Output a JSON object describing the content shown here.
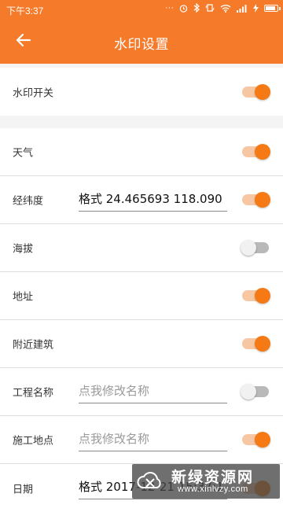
{
  "status_bar": {
    "time": "下午3:37",
    "icons": [
      "dots-icon",
      "alarm-icon",
      "bluetooth-icon",
      "rotate-icon",
      "wifi-icon",
      "signal-icon",
      "charging-icon",
      "battery-icon"
    ],
    "battery_level": 0.9
  },
  "app_bar": {
    "title": "水印设置",
    "back_icon": "arrow-left-icon"
  },
  "colors": {
    "primary": "#f57a2a",
    "switch_on_thumb": "#f57a15",
    "switch_on_track": "#f7c7a4",
    "switch_off_track": "#b9b9b9",
    "background": "#f4f4f4"
  },
  "master": {
    "label": "水印开关",
    "enabled": true
  },
  "settings": [
    {
      "id": "weather",
      "label": "天气",
      "enabled": true
    },
    {
      "id": "coordinates",
      "label": "经纬度",
      "value": "格式 24.465693 118.090",
      "enabled": true
    },
    {
      "id": "altitude",
      "label": "海拔",
      "enabled": false
    },
    {
      "id": "address",
      "label": "地址",
      "enabled": true
    },
    {
      "id": "nearby-building",
      "label": "附近建筑",
      "enabled": true
    },
    {
      "id": "project-name",
      "label": "工程名称",
      "placeholder": "点我修改名称",
      "enabled": false
    },
    {
      "id": "site",
      "label": "施工地点",
      "placeholder": "点我修改名称",
      "enabled": true
    },
    {
      "id": "date",
      "label": "日期",
      "value": "格式 2017-12-21 15:37:1",
      "enabled": true
    }
  ],
  "watermark_overlay": {
    "title": "新绿资源网",
    "subtitle": "www.xinlvzy.com"
  }
}
